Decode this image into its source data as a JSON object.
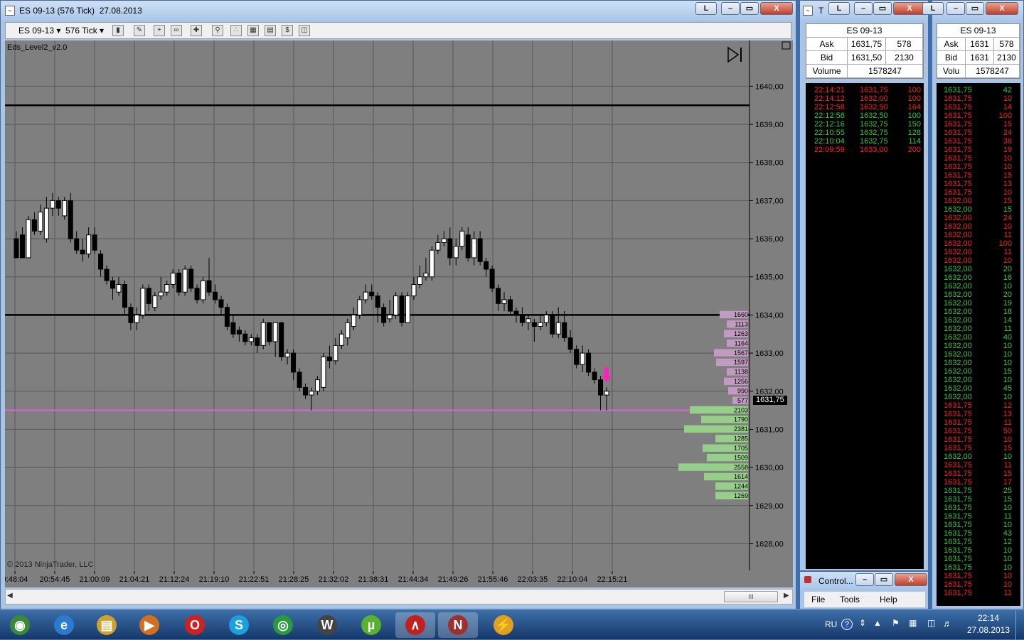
{
  "chart_window": {
    "title": "ES 09-13 (576 Tick)  27.08.2013",
    "min_label": "L",
    "max_label": "▭",
    "restore_label": "▭",
    "close_label": "X",
    "toolbar": {
      "instrument": "ES 09-13",
      "interval": "576 Tick"
    },
    "indicator_label": "Eds_Level2_v2.0",
    "copyright": "© 2013 NinjaTrader, LLC",
    "last_price_badge": "1631,75",
    "scrollbar_grip": "III"
  },
  "chart_data": {
    "type": "candlestick",
    "price_axis_ticks": [
      "1640,00",
      "1639,00",
      "1638,00",
      "1637,00",
      "1636,00",
      "1635,00",
      "1634,00",
      "1633,00",
      "1632,00",
      "1631,00",
      "1630,00",
      "1629,00",
      "1628,00"
    ],
    "price_axis_values": [
      1640,
      1639,
      1638,
      1637,
      1636,
      1635,
      1634,
      1633,
      1632,
      1631,
      1630,
      1629,
      1628
    ],
    "y_range": [
      1627.3,
      1641.2
    ],
    "time_axis_ticks": [
      "0:48:04",
      "20:54:45",
      "21:00:09",
      "21:04:21",
      "21:12:24",
      "21:19:10",
      "21:22:51",
      "21:28:25",
      "21:32:02",
      "21:38:31",
      "21:44:34",
      "21:49:26",
      "21:55:46",
      "22:03:35",
      "22:10:04",
      "22:15:21"
    ],
    "horizontal_lines": [
      {
        "price": 1639.5,
        "color": "#000000"
      },
      {
        "price": 1634.0,
        "color": "#000000"
      },
      {
        "price": 1631.5,
        "color": "#e060e0"
      }
    ],
    "candles": [
      [
        1636.0,
        1635.5,
        1636.2,
        1635.5
      ],
      [
        1636.1,
        1635.5,
        1636.3,
        1635.5
      ],
      [
        1635.5,
        1636.5,
        1636.6,
        1635.5
      ],
      [
        1636.5,
        1636.2,
        1636.7,
        1636.1
      ],
      [
        1636.2,
        1636.7,
        1636.9,
        1636.1
      ],
      [
        1636.0,
        1636.8,
        1637.1,
        1635.9
      ],
      [
        1636.8,
        1637.0,
        1637.2,
        1636.6
      ],
      [
        1637.0,
        1636.8,
        1637.1,
        1636.6
      ],
      [
        1636.6,
        1637.0,
        1637.1,
        1636.5
      ],
      [
        1637.0,
        1636.0,
        1637.2,
        1635.9
      ],
      [
        1636.0,
        1635.7,
        1636.2,
        1635.6
      ],
      [
        1635.7,
        1635.6,
        1636.0,
        1635.4
      ],
      [
        1635.6,
        1636.1,
        1636.3,
        1635.5
      ],
      [
        1636.1,
        1635.7,
        1636.3,
        1635.6
      ],
      [
        1635.6,
        1635.2,
        1635.7,
        1635.0
      ],
      [
        1635.2,
        1634.9,
        1635.3,
        1634.8
      ],
      [
        1634.9,
        1634.7,
        1635.0,
        1634.4
      ],
      [
        1634.6,
        1634.8,
        1635.0,
        1634.5
      ],
      [
        1634.8,
        1634.2,
        1634.9,
        1634.0
      ],
      [
        1634.2,
        1633.8,
        1634.3,
        1633.6
      ],
      [
        1633.8,
        1634.0,
        1634.2,
        1633.6
      ],
      [
        1634.0,
        1634.7,
        1634.8,
        1633.9
      ],
      [
        1634.7,
        1634.3,
        1634.8,
        1634.1
      ],
      [
        1634.2,
        1634.5,
        1634.6,
        1634.1
      ],
      [
        1634.5,
        1634.6,
        1635.0,
        1634.4
      ],
      [
        1634.6,
        1634.8,
        1634.9,
        1634.5
      ],
      [
        1634.8,
        1635.1,
        1635.2,
        1634.7
      ],
      [
        1635.1,
        1634.6,
        1635.2,
        1634.5
      ],
      [
        1634.6,
        1635.2,
        1635.3,
        1634.5
      ],
      [
        1635.2,
        1634.7,
        1635.3,
        1634.6
      ],
      [
        1634.7,
        1634.4,
        1634.8,
        1634.3
      ],
      [
        1634.4,
        1634.9,
        1635.0,
        1634.3
      ],
      [
        1634.9,
        1634.6,
        1635.5,
        1634.5
      ],
      [
        1634.6,
        1634.4,
        1634.8,
        1634.3
      ],
      [
        1634.4,
        1634.2,
        1634.5,
        1634.0
      ],
      [
        1634.2,
        1633.7,
        1634.3,
        1633.6
      ],
      [
        1633.8,
        1633.5,
        1634.0,
        1633.4
      ],
      [
        1633.6,
        1633.5,
        1633.7,
        1633.3
      ],
      [
        1633.5,
        1633.3,
        1633.6,
        1633.2
      ],
      [
        1633.3,
        1633.4,
        1633.5,
        1633.2
      ],
      [
        1633.4,
        1633.2,
        1633.5,
        1633.0
      ],
      [
        1633.2,
        1633.8,
        1633.9,
        1633.1
      ],
      [
        1633.8,
        1633.3,
        1633.8,
        1633.2
      ],
      [
        1633.3,
        1633.8,
        1633.8,
        1632.9
      ],
      [
        1633.8,
        1632.9,
        1633.8,
        1632.8
      ],
      [
        1632.9,
        1633.0,
        1633.1,
        1632.7
      ],
      [
        1633.0,
        1632.5,
        1633.1,
        1632.3
      ],
      [
        1632.5,
        1632.1,
        1632.6,
        1632.0
      ],
      [
        1632.1,
        1631.9,
        1632.2,
        1631.8
      ],
      [
        1631.9,
        1632.0,
        1632.1,
        1631.5
      ],
      [
        1632.0,
        1632.3,
        1632.4,
        1631.9
      ],
      [
        1632.1,
        1632.9,
        1633.0,
        1632.0
      ],
      [
        1632.9,
        1632.8,
        1633.2,
        1632.6
      ],
      [
        1632.8,
        1633.2,
        1633.4,
        1632.7
      ],
      [
        1633.2,
        1633.5,
        1633.6,
        1633.1
      ],
      [
        1633.4,
        1633.8,
        1633.9,
        1633.2
      ],
      [
        1633.7,
        1634.0,
        1634.2,
        1633.6
      ],
      [
        1634.0,
        1634.4,
        1634.5,
        1633.9
      ],
      [
        1634.4,
        1634.6,
        1634.8,
        1634.3
      ],
      [
        1634.6,
        1634.5,
        1634.8,
        1634.4
      ],
      [
        1634.5,
        1634.2,
        1634.6,
        1633.8
      ],
      [
        1634.2,
        1633.8,
        1634.3,
        1633.7
      ],
      [
        1633.9,
        1634.0,
        1634.4,
        1633.8
      ],
      [
        1634.0,
        1634.5,
        1634.6,
        1633.9
      ],
      [
        1634.5,
        1633.8,
        1634.6,
        1633.7
      ],
      [
        1633.8,
        1634.5,
        1634.6,
        1633.8
      ],
      [
        1634.5,
        1634.8,
        1635.0,
        1634.4
      ],
      [
        1634.8,
        1635.0,
        1635.3,
        1634.7
      ],
      [
        1635.0,
        1635.1,
        1635.5,
        1634.9
      ],
      [
        1635.0,
        1635.7,
        1635.8,
        1634.9
      ],
      [
        1635.7,
        1635.9,
        1636.1,
        1635.6
      ],
      [
        1635.9,
        1636.0,
        1636.2,
        1635.8
      ],
      [
        1636.0,
        1635.5,
        1636.3,
        1635.3
      ],
      [
        1635.5,
        1635.8,
        1636.0,
        1635.3
      ],
      [
        1635.8,
        1636.2,
        1636.3,
        1635.7
      ],
      [
        1636.1,
        1635.5,
        1636.3,
        1635.4
      ],
      [
        1635.5,
        1636.0,
        1636.2,
        1635.3
      ],
      [
        1636.0,
        1635.4,
        1636.2,
        1635.3
      ],
      [
        1635.4,
        1635.2,
        1635.5,
        1635.0
      ],
      [
        1635.2,
        1634.7,
        1635.3,
        1634.6
      ],
      [
        1634.7,
        1634.3,
        1634.8,
        1634.1
      ],
      [
        1634.3,
        1634.4,
        1634.6,
        1634.1
      ],
      [
        1634.4,
        1634.1,
        1634.5,
        1634.0
      ],
      [
        1634.1,
        1634.0,
        1634.2,
        1633.8
      ],
      [
        1634.0,
        1633.8,
        1634.2,
        1633.7
      ],
      [
        1633.8,
        1633.9,
        1634.0,
        1633.6
      ],
      [
        1633.8,
        1633.7,
        1633.9,
        1633.3
      ],
      [
        1633.7,
        1633.8,
        1634.0,
        1633.6
      ],
      [
        1633.8,
        1634.0,
        1634.1,
        1633.7
      ],
      [
        1634.0,
        1633.5,
        1634.1,
        1633.4
      ],
      [
        1633.5,
        1633.8,
        1634.2,
        1633.4
      ],
      [
        1633.8,
        1633.4,
        1634.1,
        1633.3
      ],
      [
        1633.4,
        1633.1,
        1633.6,
        1633.0
      ],
      [
        1633.1,
        1632.7,
        1633.2,
        1632.6
      ],
      [
        1632.7,
        1633.0,
        1633.2,
        1632.5
      ],
      [
        1633.0,
        1632.5,
        1633.1,
        1632.4
      ],
      [
        1632.5,
        1632.3,
        1632.6,
        1632.2
      ],
      [
        1632.3,
        1631.9,
        1632.4,
        1631.5
      ],
      [
        1631.9,
        1632.0,
        1632.1,
        1631.5
      ]
    ],
    "volume_profile": [
      {
        "price": 1634.0,
        "bid_label": "1660",
        "ask_width": 40,
        "side": "ask"
      },
      {
        "price": 1633.75,
        "bid_label": "1113",
        "ask_width": 30,
        "side": "ask"
      },
      {
        "price": 1633.5,
        "bid_label": "1263",
        "ask_width": 34,
        "side": "ask"
      },
      {
        "price": 1633.25,
        "bid_label": "1164",
        "ask_width": 30,
        "side": "ask"
      },
      {
        "price": 1633.0,
        "bid_label": "1567",
        "ask_width": 48,
        "side": "ask"
      },
      {
        "price": 1632.75,
        "bid_label": "1597",
        "ask_width": 45,
        "side": "ask"
      },
      {
        "price": 1632.5,
        "bid_label": "1138",
        "ask_width": 30,
        "side": "ask"
      },
      {
        "price": 1632.25,
        "bid_label": "1256",
        "ask_width": 34,
        "side": "ask"
      },
      {
        "price": 1632.0,
        "bid_label": "990",
        "ask_width": 28,
        "side": "ask"
      },
      {
        "price": 1631.75,
        "bid_label": "577",
        "ask_width": 22,
        "side": "ask"
      },
      {
        "price": 1631.5,
        "bid_label": "2103",
        "ask_width": 82,
        "side": "bid"
      },
      {
        "price": 1631.25,
        "bid_label": "1790",
        "ask_width": 66,
        "side": "bid"
      },
      {
        "price": 1631.0,
        "bid_label": "2381",
        "ask_width": 90,
        "side": "bid"
      },
      {
        "price": 1630.75,
        "bid_label": "1285",
        "ask_width": 46,
        "side": "bid"
      },
      {
        "price": 1630.5,
        "bid_label": "1705",
        "ask_width": 64,
        "side": "bid"
      },
      {
        "price": 1630.25,
        "bid_label": "1509",
        "ask_width": 58,
        "side": "bid"
      },
      {
        "price": 1630.0,
        "bid_label": "2558",
        "ask_width": 98,
        "side": "bid"
      },
      {
        "price": 1629.75,
        "bid_label": "1614",
        "ask_width": 62,
        "side": "bid"
      },
      {
        "price": 1629.5,
        "bid_label": "1244",
        "ask_width": 46,
        "side": "bid"
      },
      {
        "price": 1629.25,
        "bid_label": "1269",
        "ask_width": 46,
        "side": "bid"
      }
    ]
  },
  "level2_left": {
    "title_letter": "T",
    "instrument": "ES 09-13",
    "ask_label": "Ask",
    "ask_price": "1631,75",
    "ask_size": "578",
    "bid_label": "Bid",
    "bid_price": "1631,50",
    "bid_size": "2130",
    "volume_label": "Volume",
    "volume_value": "1578247",
    "rows": [
      {
        "time": "22:14:21",
        "price": "1631,75",
        "size": "100",
        "color": "red"
      },
      {
        "time": "22:14:12",
        "price": "1632,00",
        "size": "100",
        "color": "red"
      },
      {
        "time": "22:12:58",
        "price": "1632,50",
        "size": "164",
        "color": "red"
      },
      {
        "time": "22:12:58",
        "price": "1632,50",
        "size": "100",
        "color": "green"
      },
      {
        "time": "22:12:16",
        "price": "1632,75",
        "size": "150",
        "color": "green"
      },
      {
        "time": "22:10:55",
        "price": "1632,75",
        "size": "128",
        "color": "green"
      },
      {
        "time": "22:10:04",
        "price": "1632,75",
        "size": "114",
        "color": "green"
      },
      {
        "time": "22:09:59",
        "price": "1633,00",
        "size": "200",
        "color": "red"
      }
    ]
  },
  "level2_right": {
    "instrument": "ES 09-13",
    "ask_label": "Ask",
    "ask_price": "1631",
    "ask_size": "578",
    "bid_label": "Bid",
    "bid_price": "1631",
    "bid_size": "2130",
    "volume_label": "Volu",
    "volume_value": "1578247",
    "rows": [
      [
        "1631,75",
        "42",
        "green"
      ],
      [
        "1631,75",
        "10",
        "red"
      ],
      [
        "1631,75",
        "14",
        "red"
      ],
      [
        "1631,75",
        "100",
        "red"
      ],
      [
        "1631,75",
        "15",
        "red"
      ],
      [
        "1631,75",
        "24",
        "red"
      ],
      [
        "1631,75",
        "38",
        "red"
      ],
      [
        "1631,75",
        "19",
        "red"
      ],
      [
        "1631,75",
        "10",
        "red"
      ],
      [
        "1631,75",
        "10",
        "red"
      ],
      [
        "1631,75",
        "15",
        "red"
      ],
      [
        "1631,75",
        "13",
        "red"
      ],
      [
        "1631,75",
        "10",
        "red"
      ],
      [
        "1632,00",
        "15",
        "red"
      ],
      [
        "1632,00",
        "15",
        "green"
      ],
      [
        "1632,00",
        "24",
        "red"
      ],
      [
        "1632,00",
        "10",
        "red"
      ],
      [
        "1632,00",
        "11",
        "red"
      ],
      [
        "1632,00",
        "100",
        "red"
      ],
      [
        "1632,00",
        "11",
        "red"
      ],
      [
        "1632,00",
        "10",
        "red"
      ],
      [
        "1632,00",
        "20",
        "green"
      ],
      [
        "1632,00",
        "16",
        "green"
      ],
      [
        "1632,00",
        "10",
        "green"
      ],
      [
        "1632,00",
        "20",
        "green"
      ],
      [
        "1632,00",
        "19",
        "green"
      ],
      [
        "1632,00",
        "18",
        "green"
      ],
      [
        "1632,00",
        "14",
        "green"
      ],
      [
        "1632,00",
        "11",
        "green"
      ],
      [
        "1632,00",
        "40",
        "green"
      ],
      [
        "1632,00",
        "10",
        "green"
      ],
      [
        "1632,00",
        "10",
        "green"
      ],
      [
        "1632,00",
        "10",
        "green"
      ],
      [
        "1632,00",
        "15",
        "green"
      ],
      [
        "1632,00",
        "10",
        "green"
      ],
      [
        "1632,00",
        "45",
        "green"
      ],
      [
        "1632,00",
        "10",
        "green"
      ],
      [
        "1631,75",
        "12",
        "red"
      ],
      [
        "1631,75",
        "13",
        "red"
      ],
      [
        "1631,75",
        "11",
        "red"
      ],
      [
        "1631,75",
        "50",
        "red"
      ],
      [
        "1631,75",
        "10",
        "red"
      ],
      [
        "1631,75",
        "15",
        "red"
      ],
      [
        "1632,00",
        "10",
        "green"
      ],
      [
        "1631,75",
        "11",
        "red"
      ],
      [
        "1631,75",
        "15",
        "red"
      ],
      [
        "1631,75",
        "17",
        "red"
      ],
      [
        "1631,75",
        "25",
        "green"
      ],
      [
        "1631,75",
        "15",
        "green"
      ],
      [
        "1631,75",
        "10",
        "green"
      ],
      [
        "1631,75",
        "11",
        "green"
      ],
      [
        "1631,75",
        "10",
        "green"
      ],
      [
        "1631,75",
        "43",
        "green"
      ],
      [
        "1631,75",
        "12",
        "green"
      ],
      [
        "1631,75",
        "10",
        "green"
      ],
      [
        "1631,75",
        "10",
        "green"
      ],
      [
        "1631,75",
        "10",
        "green"
      ],
      [
        "1631,75",
        "10",
        "red"
      ],
      [
        "1631,75",
        "10",
        "red"
      ],
      [
        "1631,75",
        "11",
        "red"
      ]
    ]
  },
  "control_center": {
    "title": "Control...",
    "menu": [
      "File",
      "Tools",
      "Help"
    ]
  },
  "taskbar": {
    "apps": [
      {
        "name": "start",
        "glyph": "◉",
        "color": "#3a8a3a"
      },
      {
        "name": "ie",
        "glyph": "e",
        "color": "#2a7ad0"
      },
      {
        "name": "explorer",
        "glyph": "▤",
        "color": "#d0a030"
      },
      {
        "name": "media",
        "glyph": "▶",
        "color": "#d07020"
      },
      {
        "name": "opera",
        "glyph": "O",
        "color": "#d02020"
      },
      {
        "name": "skype",
        "glyph": "S",
        "color": "#1aa0e0"
      },
      {
        "name": "chrome",
        "glyph": "◎",
        "color": "#2a9a40"
      },
      {
        "name": "wot",
        "glyph": "W",
        "color": "#444"
      },
      {
        "name": "utorrent",
        "glyph": "µ",
        "color": "#5ab030"
      },
      {
        "name": "ninjatrader",
        "glyph": "∧",
        "color": "#c02020"
      },
      {
        "name": "ninja2",
        "glyph": "N",
        "color": "#a03030"
      },
      {
        "name": "winamp",
        "glyph": "⚡",
        "color": "#e0a020"
      }
    ],
    "lang": "RU",
    "time": "22:14",
    "date": "27.08.2013"
  }
}
